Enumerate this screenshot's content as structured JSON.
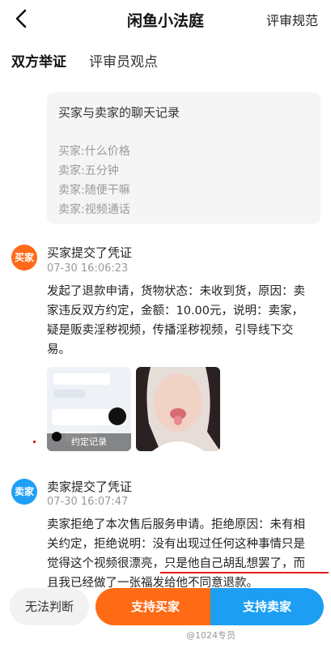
{
  "header": {
    "title": "闲鱼小法庭",
    "rules_label": "评审规范"
  },
  "tabs": [
    "双方举证",
    "评审员观点"
  ],
  "chat": {
    "title": "买家与卖家的聊天记录",
    "lines": [
      "买家:什么价格",
      "卖家:五分钟",
      "卖家:随便干嘛",
      "卖家:视频通话"
    ]
  },
  "buyer_event": {
    "avatar": "买家",
    "title": "买家提交了凭证",
    "time": "07-30 16:06:23",
    "lines": [
      "发起了退款申请，货物状态：未收到货，原因：卖",
      "家违反双方约定，金额：10.00元，说明：卖家，",
      "疑是贩卖淫秽视频，传播淫秽视频，引导线下交",
      "易。"
    ],
    "thumb_caption": "约定记录"
  },
  "seller_event": {
    "avatar": "卖家",
    "title": "卖家提交了凭证",
    "time": "07-30 16:07:47",
    "lines": [
      "卖家拒绝了本次售后服务申请。拒绝原因：未有相",
      "关约定，拒绝说明：没有出现过任何这种事情只是",
      "觉得这个视频很漂亮，只是他自己胡乱想罢了，而",
      "且我已经做了一张福发给他不同意退款。"
    ]
  },
  "bottom": {
    "none_label": "无法判断",
    "buyer_label": "支持买家",
    "seller_label": "支持卖家",
    "watermark": "@1024专员"
  },
  "colors": {
    "buyer": "#ff6a14",
    "seller": "#1c9ff2",
    "tab_underline": "#ffe033",
    "annotation": "#e81c1c"
  }
}
